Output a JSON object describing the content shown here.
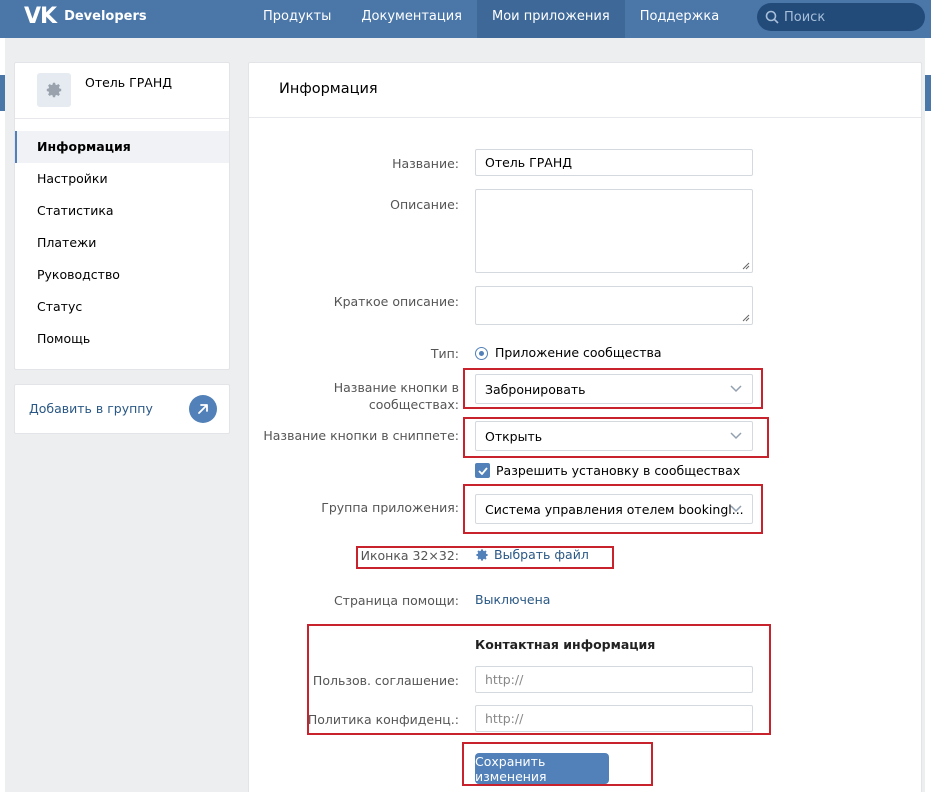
{
  "header": {
    "logo_mark": "VK",
    "logo_text": "Developers",
    "nav": [
      "Продукты",
      "Документация",
      "Мои приложения",
      "Поддержка"
    ],
    "search_placeholder": "Поиск"
  },
  "sidebar": {
    "app_name": "Отель ГРАНД",
    "items": [
      "Информация",
      "Настройки",
      "Статистика",
      "Платежи",
      "Руководство",
      "Статус",
      "Помощь"
    ],
    "active": "Информация",
    "add_to_group": "Добавить в группу"
  },
  "main": {
    "title": "Информация",
    "name_label": "Название:",
    "name_value": "Отель ГРАНД",
    "description_label": "Описание:",
    "short_description_label": "Краткое описание:",
    "type_label": "Тип:",
    "type_value": "Приложение сообщества",
    "community_button_label_l1": "Название кнопки в",
    "community_button_label_l2": "сообществах:",
    "community_button_value": "Забронировать",
    "snippet_button_label": "Название кнопки в сниппете:",
    "snippet_button_value": "Открыть",
    "allow_install_label": "Разрешить установку в сообществах",
    "app_group_label": "Группа приложения:",
    "app_group_value": "Система управления отелем bookingl...",
    "icon_label": "Иконка 32×32:",
    "choose_file": "Выбрать файл",
    "help_page_label": "Страница помощи:",
    "help_page_value": "Выключена",
    "contact_heading": "Контактная информация",
    "user_agreement_label": "Пользов. соглашение:",
    "user_agreement_placeholder": "http://",
    "privacy_label": "Политика конфиденц.:",
    "privacy_placeholder": "http://",
    "save_button": "Сохранить изменения"
  },
  "colors": {
    "header_bg": "#4a76a8",
    "accent": "#5181b8",
    "link": "#2a5885",
    "highlight_box": "#c8232c"
  },
  "icons": [
    "search-icon",
    "gear-icon",
    "arrow-up-right-icon",
    "chevron-down-icon",
    "checkmark-icon",
    "gear-small-icon"
  ]
}
